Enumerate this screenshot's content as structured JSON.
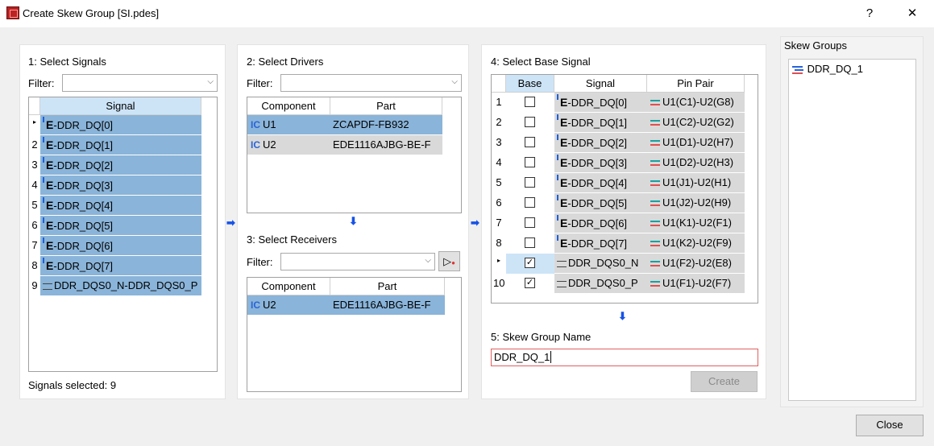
{
  "window": {
    "title": "Create Skew Group [SI.pdes]",
    "help": "?",
    "close": "✕"
  },
  "step1": {
    "title": "1:  Select Signals",
    "filter_label": "Filter:",
    "header": "Signal",
    "rows": [
      {
        "num": "",
        "label": "DDR_DQ[0]"
      },
      {
        "num": "2",
        "label": "DDR_DQ[1]"
      },
      {
        "num": "3",
        "label": "DDR_DQ[2]"
      },
      {
        "num": "4",
        "label": "DDR_DQ[3]"
      },
      {
        "num": "5",
        "label": "DDR_DQ[4]"
      },
      {
        "num": "6",
        "label": "DDR_DQ[5]"
      },
      {
        "num": "7",
        "label": "DDR_DQ[6]"
      },
      {
        "num": "8",
        "label": "DDR_DQ[7]"
      },
      {
        "num": "9",
        "label": "DDR_DQS0_N-DDR_DQS0_P"
      }
    ],
    "status": "Signals selected: 9"
  },
  "step2": {
    "title": "2:  Select Drivers",
    "filter_label": "Filter:",
    "headers": [
      "Component",
      "Part"
    ],
    "rows": [
      {
        "comp": "U1",
        "part": "ZCAPDF-FB932"
      },
      {
        "comp": "U2",
        "part": "EDE1116AJBG-BE-F"
      }
    ]
  },
  "step3": {
    "title": "3:  Select Receivers",
    "filter_label": "Filter:",
    "headers": [
      "Component",
      "Part"
    ],
    "rows": [
      {
        "comp": "U2",
        "part": "EDE1116AJBG-BE-F"
      }
    ]
  },
  "step4": {
    "title": "4:  Select Base Signal",
    "headers": [
      "Base",
      "Signal",
      "Pin Pair"
    ],
    "rows": [
      {
        "num": "1",
        "checked": false,
        "signal": "DDR_DQ[0]",
        "pins": "U1(C1)-U2(G8)"
      },
      {
        "num": "2",
        "checked": false,
        "signal": "DDR_DQ[1]",
        "pins": "U1(C2)-U2(G2)"
      },
      {
        "num": "3",
        "checked": false,
        "signal": "DDR_DQ[2]",
        "pins": "U1(D1)-U2(H7)"
      },
      {
        "num": "4",
        "checked": false,
        "signal": "DDR_DQ[3]",
        "pins": "U1(D2)-U2(H3)"
      },
      {
        "num": "5",
        "checked": false,
        "signal": "DDR_DQ[4]",
        "pins": "U1(J1)-U2(H1)"
      },
      {
        "num": "6",
        "checked": false,
        "signal": "DDR_DQ[5]",
        "pins": "U1(J2)-U2(H9)"
      },
      {
        "num": "7",
        "checked": false,
        "signal": "DDR_DQ[6]",
        "pins": "U1(K1)-U2(F1)"
      },
      {
        "num": "8",
        "checked": false,
        "signal": "DDR_DQ[7]",
        "pins": "U1(K2)-U2(F9)"
      },
      {
        "num": "",
        "checked": true,
        "signal": "DDR_DQS0_N",
        "pins": "U1(F2)-U2(E8)"
      },
      {
        "num": "10",
        "checked": true,
        "signal": "DDR_DQS0_P",
        "pins": "U1(F1)-U2(F7)"
      }
    ]
  },
  "step5": {
    "title": "5: Skew Group Name",
    "value": "DDR_DQ_1",
    "create_label": "Create"
  },
  "skew_groups": {
    "title": "Skew Groups",
    "items": [
      "DDR_DQ_1"
    ]
  },
  "footer": {
    "close_label": "Close"
  },
  "colors": {
    "selection": "#8ab4d9",
    "header_selected": "#cde4f7",
    "arrow": "#1652e6"
  }
}
